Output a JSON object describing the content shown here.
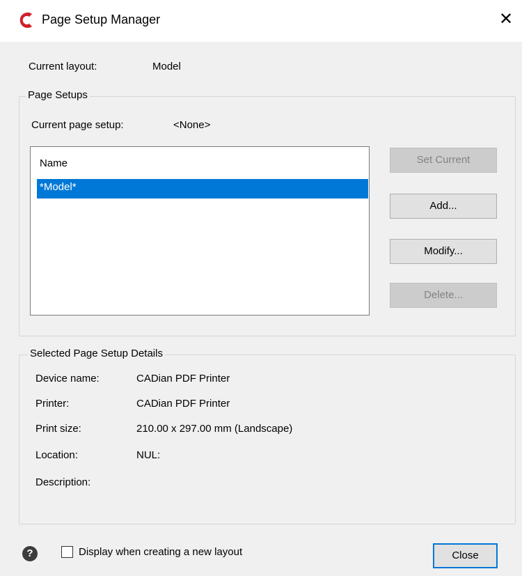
{
  "window": {
    "title": "Page Setup Manager",
    "close_glyph": "✕",
    "app_icon": "cadian-logo-icon"
  },
  "current_layout": {
    "label": "Current layout:",
    "value": "Model"
  },
  "page_setups": {
    "group_title": "Page Setups",
    "current_label": "Current page setup:",
    "current_value": "<None>",
    "list": {
      "header": "Name",
      "items": [
        "*Model*"
      ],
      "selected_index": 0
    },
    "buttons": {
      "set_current": "Set Current",
      "add": "Add...",
      "modify": "Modify...",
      "delete": "Delete..."
    }
  },
  "details": {
    "group_title": "Selected Page Setup Details",
    "rows": [
      {
        "label": "Device name:",
        "value": "CADian PDF Printer"
      },
      {
        "label": "Printer:",
        "value": "CADian PDF Printer"
      },
      {
        "label": "Print size:",
        "value": "210.00 x 297.00 mm (Landscape)"
      },
      {
        "label": "Location:",
        "value": "NUL:"
      },
      {
        "label": "Description:",
        "value": ""
      }
    ]
  },
  "footer": {
    "help_glyph": "?",
    "checkbox_label": "Display when creating a new layout",
    "checkbox_checked": false,
    "close_label": "Close"
  },
  "colors": {
    "accent": "#0078d7",
    "dialog_bg": "#f0f0f0",
    "brand_red": "#d0202a"
  }
}
